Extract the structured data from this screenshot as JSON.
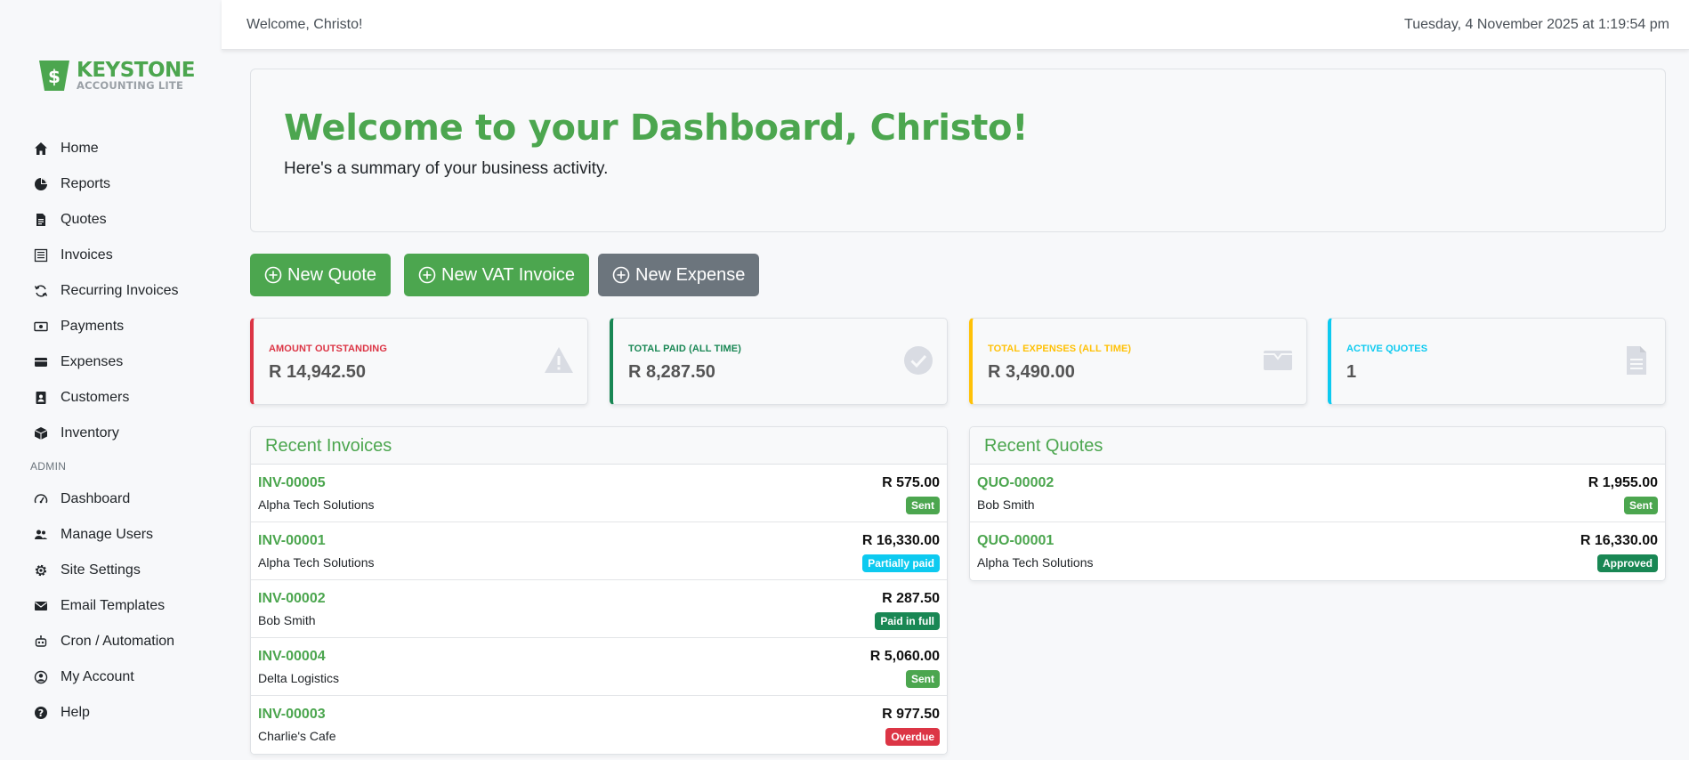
{
  "brand": {
    "name": "KEYSTONE",
    "tagline": "ACCOUNTING LITE",
    "accent": "#4ca64f"
  },
  "topbar": {
    "welcome": "Welcome, Christo!",
    "datetime": "Tuesday, 4 November 2025 at 1:19:54 pm"
  },
  "nav": {
    "items": [
      {
        "label": "Home",
        "icon": "home-icon"
      },
      {
        "label": "Reports",
        "icon": "pie-chart-icon"
      },
      {
        "label": "Quotes",
        "icon": "document-icon"
      },
      {
        "label": "Invoices",
        "icon": "ledger-icon"
      },
      {
        "label": "Recurring Invoices",
        "icon": "refresh-icon"
      },
      {
        "label": "Payments",
        "icon": "cash-icon"
      },
      {
        "label": "Expenses",
        "icon": "wallet-icon"
      },
      {
        "label": "Customers",
        "icon": "contact-card-icon"
      },
      {
        "label": "Inventory",
        "icon": "box-icon"
      }
    ],
    "admin_label": "ADMIN",
    "admin_items": [
      {
        "label": "Dashboard",
        "icon": "speedometer-icon"
      },
      {
        "label": "Manage Users",
        "icon": "users-icon"
      },
      {
        "label": "Site Settings",
        "icon": "gear-icon"
      },
      {
        "label": "Email Templates",
        "icon": "envelope-icon"
      },
      {
        "label": "Cron / Automation",
        "icon": "robot-icon"
      },
      {
        "label": "My Account",
        "icon": "user-circle-icon"
      },
      {
        "label": "Help",
        "icon": "question-icon"
      }
    ]
  },
  "hero": {
    "title": "Welcome to your Dashboard, Christo!",
    "subtitle": "Here's a summary of your business activity."
  },
  "actions": {
    "new_quote": "New Quote",
    "new_vat_invoice": "New VAT Invoice",
    "new_expense": "New Expense"
  },
  "stats": [
    {
      "label": "AMOUNT OUTSTANDING",
      "value": "R 14,942.50",
      "color": "#dc3545",
      "icon": "warning-icon"
    },
    {
      "label": "TOTAL PAID (ALL TIME)",
      "value": "R 8,287.50",
      "color": "#198754",
      "icon": "check-circle-icon"
    },
    {
      "label": "TOTAL EXPENSES (ALL TIME)",
      "value": "R 3,490.00",
      "color": "#ffc107",
      "icon": "wallet-icon"
    },
    {
      "label": "ACTIVE QUOTES",
      "value": "1",
      "color": "#0dcaf0",
      "icon": "document-icon"
    }
  ],
  "recent_invoices": {
    "title": "Recent Invoices",
    "rows": [
      {
        "number": "INV-00005",
        "customer": "Alpha Tech Solutions",
        "amount": "R 575.00",
        "status": "Sent",
        "status_color": "#4ca64f"
      },
      {
        "number": "INV-00001",
        "customer": "Alpha Tech Solutions",
        "amount": "R 16,330.00",
        "status": "Partially paid",
        "status_color": "#0dcaf0"
      },
      {
        "number": "INV-00002",
        "customer": "Bob Smith",
        "amount": "R 287.50",
        "status": "Paid in full",
        "status_color": "#198754"
      },
      {
        "number": "INV-00004",
        "customer": "Delta Logistics",
        "amount": "R 5,060.00",
        "status": "Sent",
        "status_color": "#4ca64f"
      },
      {
        "number": "INV-00003",
        "customer": "Charlie's Cafe",
        "amount": "R 977.50",
        "status": "Overdue",
        "status_color": "#dc3545"
      }
    ]
  },
  "recent_quotes": {
    "title": "Recent Quotes",
    "rows": [
      {
        "number": "QUO-00002",
        "customer": "Bob Smith",
        "amount": "R 1,955.00",
        "status": "Sent",
        "status_color": "#4ca64f"
      },
      {
        "number": "QUO-00001",
        "customer": "Alpha Tech Solutions",
        "amount": "R 16,330.00",
        "status": "Approved",
        "status_color": "#198754"
      }
    ]
  }
}
